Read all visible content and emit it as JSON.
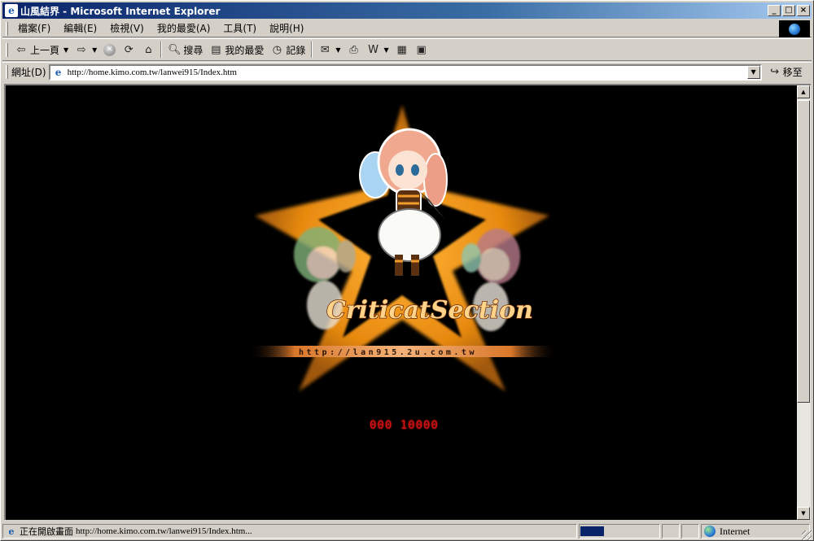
{
  "window": {
    "title": "山風結界 - Microsoft Internet Explorer",
    "controls": [
      "_",
      "□",
      "×"
    ]
  },
  "menu": [
    "檔案(F)",
    "編輯(E)",
    "檢視(V)",
    "我的最愛(A)",
    "工具(T)",
    "說明(H)"
  ],
  "toolbar": {
    "back": "上一頁",
    "search": "搜尋",
    "favorites": "我的最愛",
    "history": "記錄"
  },
  "address": {
    "label": "網址(D)",
    "url": "http://home.kimo.com.tw/lanwei915/Index.htm",
    "go": "移至"
  },
  "page": {
    "logo": "CriticatSection",
    "strip_url": "http://lan915.2u.com.tw",
    "counter": "000 10000",
    "colors": {
      "background": "#000000",
      "star": "#f5a019",
      "counter": "#e01010"
    }
  },
  "status": {
    "text": "正在開啟畫面",
    "url": "http://home.kimo.com.tw/lanwei915/Index.htm...",
    "progress": 0.3,
    "zone": "Internet"
  }
}
